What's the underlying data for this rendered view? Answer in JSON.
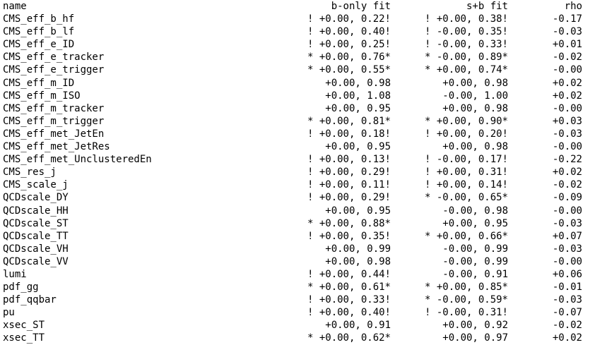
{
  "terminal": {
    "header": {
      "name": "name",
      "b_only_fit": "b-only fit",
      "s_plus_b_fit": "s+b fit",
      "rho": "rho"
    },
    "rows": [
      {
        "name": "CMS_eff_b_hf",
        "b": "! +0.00, 0.22!",
        "sb": "! +0.00, 0.38!",
        "rho": "-0.17"
      },
      {
        "name": "CMS_eff_b_lf",
        "b": "! +0.00, 0.40!",
        "sb": "! -0.00, 0.35!",
        "rho": "-0.03"
      },
      {
        "name": "CMS_eff_e_ID",
        "b": "! +0.00, 0.25!",
        "sb": "! -0.00, 0.33!",
        "rho": "+0.01"
      },
      {
        "name": "CMS_eff_e_tracker",
        "b": "* +0.00, 0.76*",
        "sb": "* -0.00, 0.89*",
        "rho": "-0.02"
      },
      {
        "name": "CMS_eff_e_trigger",
        "b": "* +0.00, 0.55*",
        "sb": "* +0.00, 0.74*",
        "rho": "-0.00"
      },
      {
        "name": "CMS_eff_m_ID",
        "b": "+0.00, 0.98",
        "sb": "+0.00, 0.98",
        "rho": "+0.02"
      },
      {
        "name": "CMS_eff_m_ISO",
        "b": "+0.00, 1.08",
        "sb": "-0.00, 1.00",
        "rho": "+0.02"
      },
      {
        "name": "CMS_eff_m_tracker",
        "b": "+0.00, 0.95",
        "sb": "+0.00, 0.98",
        "rho": "-0.00"
      },
      {
        "name": "CMS_eff_m_trigger",
        "b": "* +0.00, 0.81*",
        "sb": "* +0.00, 0.90*",
        "rho": "+0.03"
      },
      {
        "name": "CMS_eff_met_JetEn",
        "b": "! +0.00, 0.18!",
        "sb": "! +0.00, 0.20!",
        "rho": "-0.03"
      },
      {
        "name": "CMS_eff_met_JetRes",
        "b": "+0.00, 0.95",
        "sb": "+0.00, 0.98",
        "rho": "-0.00"
      },
      {
        "name": "CMS_eff_met_UnclusteredEn",
        "b": "! +0.00, 0.13!",
        "sb": "! -0.00, 0.17!",
        "rho": "-0.22"
      },
      {
        "name": "CMS_res_j",
        "b": "! +0.00, 0.29!",
        "sb": "! +0.00, 0.31!",
        "rho": "+0.02"
      },
      {
        "name": "CMS_scale_j",
        "b": "! +0.00, 0.11!",
        "sb": "! +0.00, 0.14!",
        "rho": "-0.02"
      },
      {
        "name": "QCDscale_DY",
        "b": "! +0.00, 0.29!",
        "sb": "* -0.00, 0.65*",
        "rho": "-0.09"
      },
      {
        "name": "QCDscale_HH",
        "b": "+0.00, 0.95",
        "sb": "-0.00, 0.98",
        "rho": "-0.00"
      },
      {
        "name": "QCDscale_ST",
        "b": "* +0.00, 0.88*",
        "sb": "+0.00, 0.95",
        "rho": "-0.03"
      },
      {
        "name": "QCDscale_TT",
        "b": "! +0.00, 0.35!",
        "sb": "* +0.00, 0.66*",
        "rho": "+0.07"
      },
      {
        "name": "QCDscale_VH",
        "b": "+0.00, 0.99",
        "sb": "-0.00, 0.99",
        "rho": "-0.03"
      },
      {
        "name": "QCDscale_VV",
        "b": "+0.00, 0.98",
        "sb": "-0.00, 0.99",
        "rho": "-0.00"
      },
      {
        "name": "lumi",
        "b": "! +0.00, 0.44!",
        "sb": "-0.00, 0.91",
        "rho": "+0.06"
      },
      {
        "name": "pdf_gg",
        "b": "* +0.00, 0.61*",
        "sb": "* +0.00, 0.85*",
        "rho": "-0.01"
      },
      {
        "name": "pdf_qqbar",
        "b": "! +0.00, 0.33!",
        "sb": "* -0.00, 0.59*",
        "rho": "-0.03"
      },
      {
        "name": "pu",
        "b": "! +0.00, 0.40!",
        "sb": "! -0.00, 0.31!",
        "rho": "-0.07"
      },
      {
        "name": "xsec_ST",
        "b": "+0.00, 0.91",
        "sb": "+0.00, 0.92",
        "rho": "-0.02"
      },
      {
        "name": "xsec_TT",
        "b": "* +0.00, 0.62*",
        "sb": "+0.00, 0.97",
        "rho": "+0.02"
      }
    ]
  }
}
